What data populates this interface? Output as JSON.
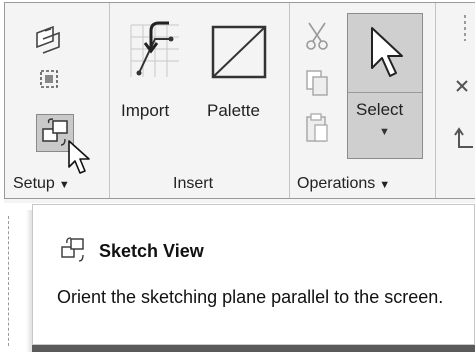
{
  "ribbon": {
    "groups": [
      {
        "label": "Setup"
      },
      {
        "label": "Insert"
      },
      {
        "label": "Operations"
      }
    ],
    "insert_buttons": {
      "import_label": "Import",
      "palette_label": "Palette"
    },
    "select_button": {
      "label": "Select"
    },
    "icons": [
      "sketch-plane-icon",
      "slice-graphics-icon",
      "sketch-view-icon",
      "import-icon",
      "palette-icon",
      "scissors-icon",
      "copy-icon",
      "paste-icon",
      "select-arrow-icon",
      "mouse-cursor-icon"
    ]
  },
  "tooltip": {
    "title": "Sketch View",
    "description": "Orient the sketching plane parallel to the screen."
  },
  "colors": {
    "ribbon_bg": "#f4f4f4",
    "pressed_bg": "#cfcfcf",
    "tooltip_bg": "#ffffff"
  }
}
